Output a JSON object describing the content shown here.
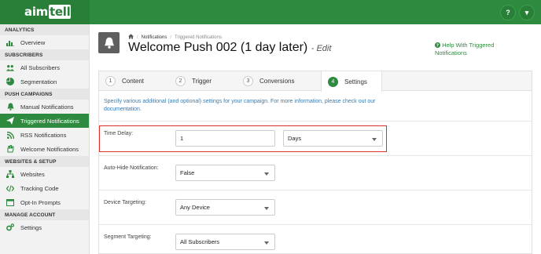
{
  "header": {
    "logo_main": "aim",
    "logo_tell": "tell",
    "help_button": "?",
    "dropdown_button": "▾"
  },
  "sidebar": {
    "sections": [
      {
        "title": "ANALYTICS",
        "items": [
          {
            "label": "Overview",
            "icon": "chart-icon"
          }
        ]
      },
      {
        "title": "SUBSCRIBERS",
        "items": [
          {
            "label": "All Subscribers",
            "icon": "users-icon"
          },
          {
            "label": "Segmentation",
            "icon": "pie-icon"
          }
        ]
      },
      {
        "title": "PUSH CAMPAIGNS",
        "items": [
          {
            "label": "Manual Notifications",
            "icon": "bell-icon"
          },
          {
            "label": "Triggered Notifications",
            "icon": "paper-plane-icon",
            "active": true
          },
          {
            "label": "RSS Notifications",
            "icon": "rss-icon"
          },
          {
            "label": "Welcome Notifications",
            "icon": "hand-icon"
          }
        ]
      },
      {
        "title": "WEBSITES & SETUP",
        "items": [
          {
            "label": "Websites",
            "icon": "sitemap-icon"
          },
          {
            "label": "Tracking Code",
            "icon": "code-icon"
          },
          {
            "label": "Opt-In Prompts",
            "icon": "window-icon"
          }
        ]
      },
      {
        "title": "MANAGE ACCOUNT",
        "items": [
          {
            "label": "Settings",
            "icon": "gears-icon"
          }
        ]
      }
    ]
  },
  "breadcrumb": {
    "home_icon": "home-icon",
    "item1": "Notifications",
    "separator": "/",
    "item2": "Triggered Notifications"
  },
  "page": {
    "title": "Welcome Push 002 (1 day later)",
    "edit_suffix": "- Edit",
    "help_text": "Help With Triggered Notifications"
  },
  "tabs": [
    {
      "num": "1",
      "label": "Content"
    },
    {
      "num": "2",
      "label": "Trigger"
    },
    {
      "num": "3",
      "label": "Conversions"
    },
    {
      "num": "4",
      "label": "Settings",
      "active": true
    }
  ],
  "settings": {
    "intro_text": "Specify various additional (and optional) settings for your campaign. For more information, please check out our",
    "intro_link": "documentation",
    "intro_end": ".",
    "time_delay": {
      "label": "Time Delay:",
      "value": "1",
      "unit": "Days"
    },
    "auto_hide": {
      "label": "Auto-Hide Notification:",
      "value": "False"
    },
    "device_targeting": {
      "label": "Device Targeting:",
      "value": "Any Device"
    },
    "segment_targeting": {
      "label": "Segment Targeting:",
      "value": "All Subscribers"
    }
  },
  "colors": {
    "brand_green": "#2e8a3e",
    "link_blue": "#2a7bbf",
    "highlight_red": "#d9302a"
  }
}
